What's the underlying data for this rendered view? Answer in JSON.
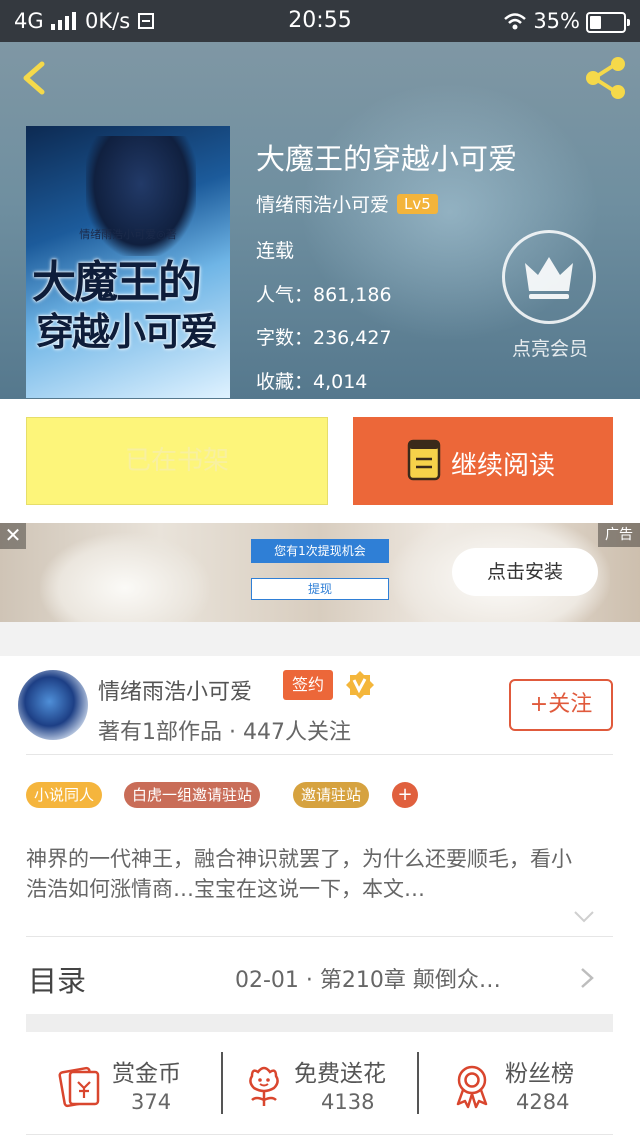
{
  "status_bar": {
    "network": "4G",
    "speed": "0K/s",
    "time": "20:55",
    "battery": "35%"
  },
  "book": {
    "title": "大魔王的穿越小可爱",
    "author": "情绪雨浩小可爱",
    "level": "Lv5",
    "status": "连载",
    "popularity": "人气：861,186",
    "word_count": "字数：236,427",
    "favorites": "收藏：4,014",
    "cover": {
      "author_credit": "情绪雨浩小可爱◎著",
      "title_line1": "大魔王的",
      "title_line2": "穿越小可爱"
    }
  },
  "vip": {
    "label": "点亮会员"
  },
  "actions": {
    "on_shelf": "已在书架",
    "continue_reading": "继续阅读"
  },
  "ad": {
    "close": "✕",
    "tag": "广告",
    "banner_text": "您有1次提现机会",
    "banner_button": "提现",
    "install": "点击安装"
  },
  "author_card": {
    "name": "情绪雨浩小可爱",
    "signed": "签约",
    "stats_line": "著有1部作品 · 447人关注",
    "follow": "+关注"
  },
  "tags": [
    {
      "label": "小说同人",
      "color": "#f5b53d"
    },
    {
      "label": "白虎一组邀请驻站",
      "color": "#c96d58"
    },
    {
      "label": "邀请驻站",
      "color": "#d6a23f"
    }
  ],
  "tag_add": "+",
  "description": "神界的一代神王，融合神识就罢了，为什么还要顺毛，看小浩浩如何涨情商…宝宝在这说一下，本文…",
  "toc": {
    "label": "目录",
    "latest": "02-01 · 第210章 颠倒众…"
  },
  "stats": [
    {
      "label": "赏金币",
      "value": "374",
      "icon": "reward-coin-icon"
    },
    {
      "label": "免费送花",
      "value": "4138",
      "icon": "flower-icon"
    },
    {
      "label": "粉丝榜",
      "value": "4284",
      "icon": "fan-rank-icon"
    }
  ],
  "colors": {
    "accent": "#ec6739",
    "shelf_button": "#fdf57a",
    "level_badge": "#f3b43b"
  }
}
